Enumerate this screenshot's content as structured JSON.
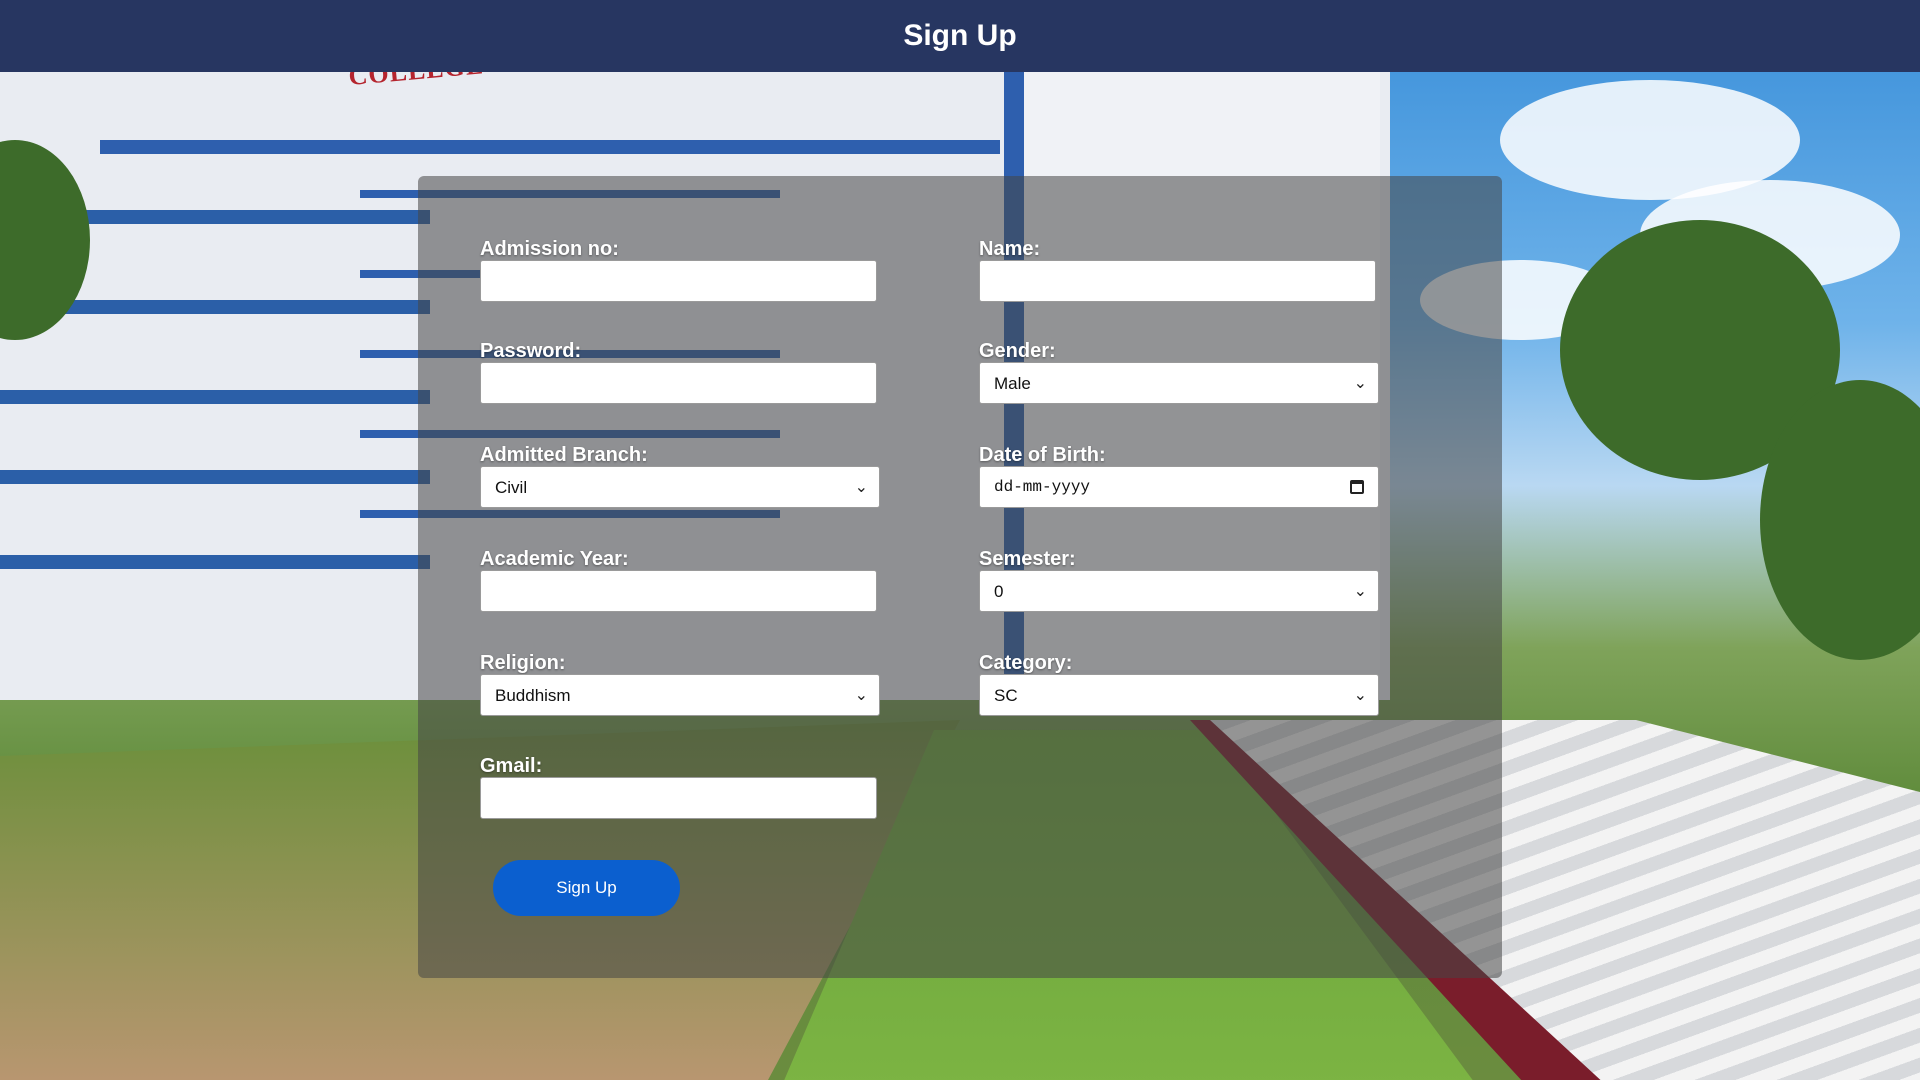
{
  "header": {
    "title": "Sign Up"
  },
  "background": {
    "sign_text": "COLLEGE OF ENGINEERING"
  },
  "form": {
    "admission_no": {
      "label": "Admission no:",
      "value": ""
    },
    "name": {
      "label": "Name:",
      "value": ""
    },
    "password": {
      "label": "Password:",
      "value": ""
    },
    "gender": {
      "label": "Gender:",
      "selected": "Male"
    },
    "admitted_branch": {
      "label": "Admitted Branch:",
      "selected": "Civil"
    },
    "date_of_birth": {
      "label": "Date of Birth:",
      "placeholder": "dd-mm-yyyy"
    },
    "academic_year": {
      "label": "Academic Year:",
      "value": ""
    },
    "semester": {
      "label": "Semester:",
      "selected": "0"
    },
    "religion": {
      "label": "Religion:",
      "selected": "Buddhism"
    },
    "category": {
      "label": "Category:",
      "selected": "SC"
    },
    "gmail": {
      "label": "Gmail:",
      "value": ""
    },
    "submit_label": "Sign Up"
  },
  "icons": {
    "dropdown": "chevron-down-icon",
    "calendar": "calendar-icon"
  },
  "colors": {
    "header_bg": "#273661",
    "button_bg": "#0b5fcf",
    "panel_bg": "rgba(70,70,70,0.55)",
    "sign_text": "#b4242e"
  }
}
